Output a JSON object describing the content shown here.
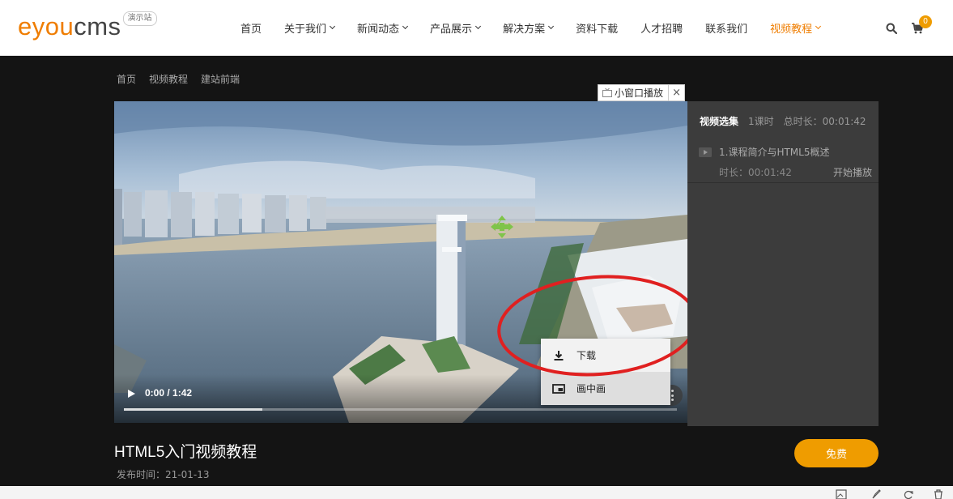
{
  "header": {
    "logo_text_brand": "eyou",
    "logo_text_rest": "cms",
    "demo_badge": "演示站",
    "nav": [
      {
        "label": "首页",
        "dropdown": false
      },
      {
        "label": "关于我们",
        "dropdown": true
      },
      {
        "label": "新闻动态",
        "dropdown": true
      },
      {
        "label": "产品展示",
        "dropdown": true
      },
      {
        "label": "解决方案",
        "dropdown": true
      },
      {
        "label": "资料下载",
        "dropdown": false
      },
      {
        "label": "人才招聘",
        "dropdown": false
      },
      {
        "label": "联系我们",
        "dropdown": false
      },
      {
        "label": "视频教程",
        "dropdown": true,
        "active": true
      }
    ],
    "cart_count": "0",
    "accent_color": "#ef7d00"
  },
  "breadcrumb": [
    "首页",
    "视频教程",
    "建站前端"
  ],
  "mini_window": {
    "label": "小窗口播放",
    "close": "×"
  },
  "player": {
    "time": "0:00 / 1:42",
    "buffered_fraction": 0.25,
    "menu": [
      {
        "label": "下载",
        "icon": "download-icon"
      },
      {
        "label": "画中画",
        "icon": "picture-in-picture-icon"
      }
    ]
  },
  "playlist": {
    "title": "视频选集",
    "count": "1课时",
    "total": "总时长：00:01:42",
    "items": [
      {
        "lesson": "1.课程简介与HTML5概述",
        "duration": "时长：00:01:42",
        "action": "开始播放"
      }
    ]
  },
  "course": {
    "title": "HTML5入门视频教程",
    "publish": "发布时间：21-01-13",
    "price_button": "免费"
  }
}
